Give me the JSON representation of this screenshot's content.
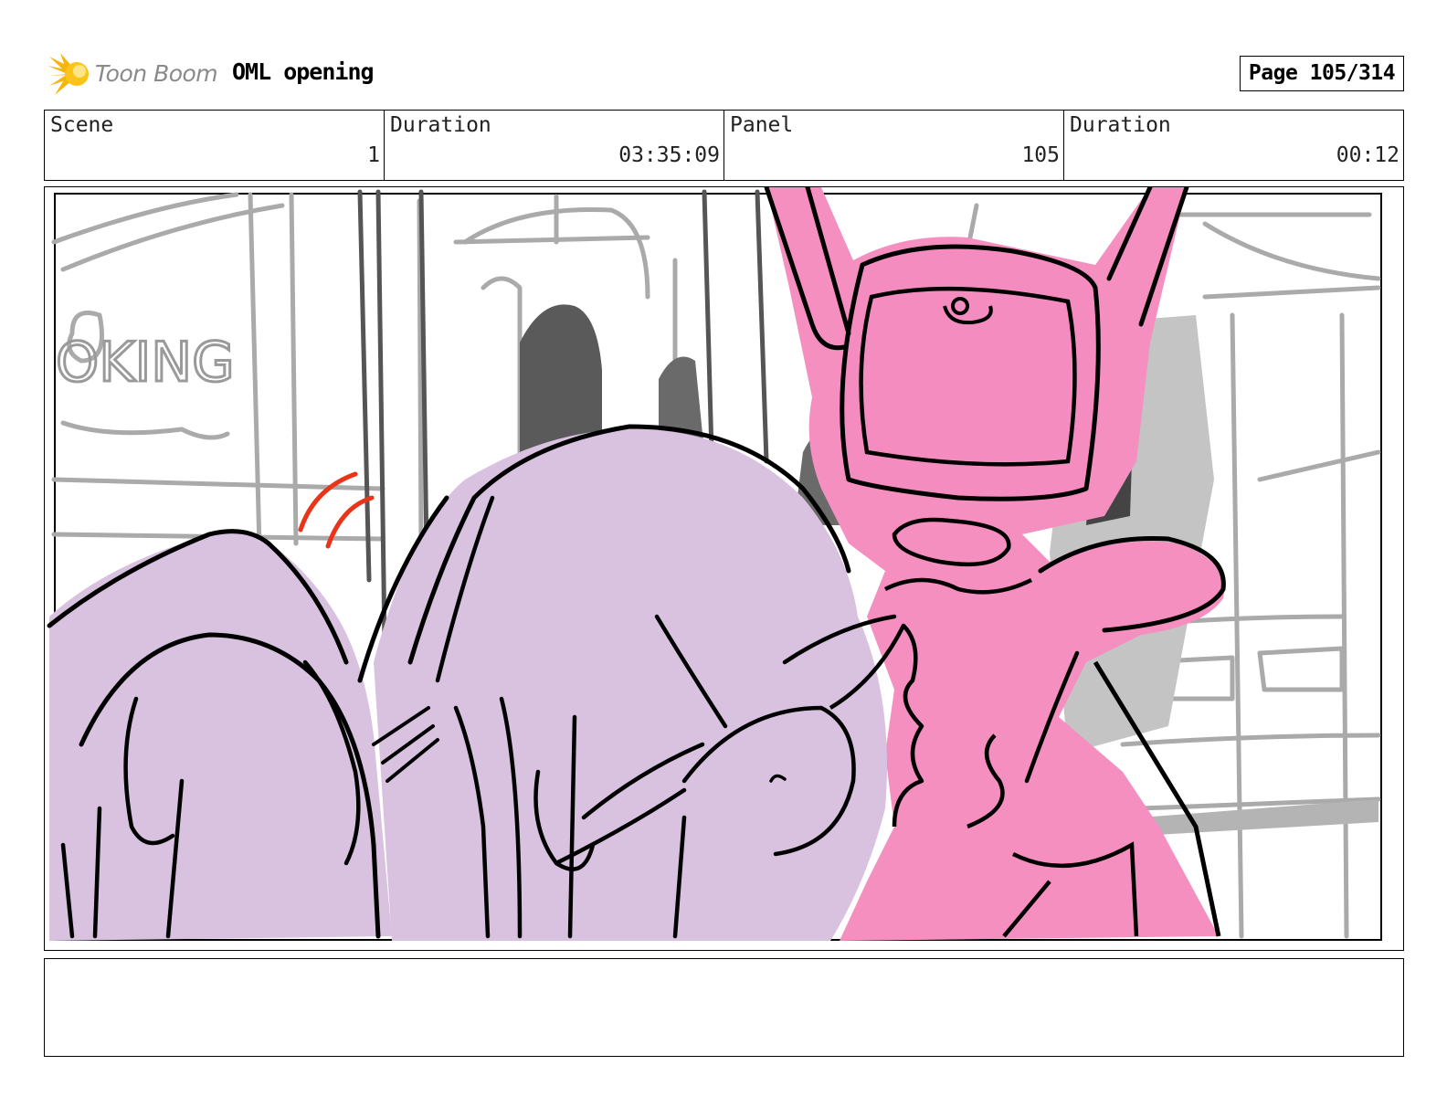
{
  "header": {
    "logo_text": "Toon Boom",
    "project_title": "OML opening",
    "page_indicator": "Page 105/314"
  },
  "info": {
    "scene_label": "Scene",
    "scene_value": "1",
    "scene_duration_label": "Duration",
    "scene_duration_value": "03:35:09",
    "panel_label": "Panel",
    "panel_value": "105",
    "panel_duration_label": "Duration",
    "panel_duration_value": "00:12"
  },
  "panel": {
    "sketch_sign_text": "OKING"
  },
  "notes": {
    "text": ""
  },
  "colors": {
    "pink_character": "#f48fbf",
    "purple_character": "#d9c1e0",
    "red_accent": "#e8351a",
    "sketch_gray": "#a8a8a8"
  }
}
